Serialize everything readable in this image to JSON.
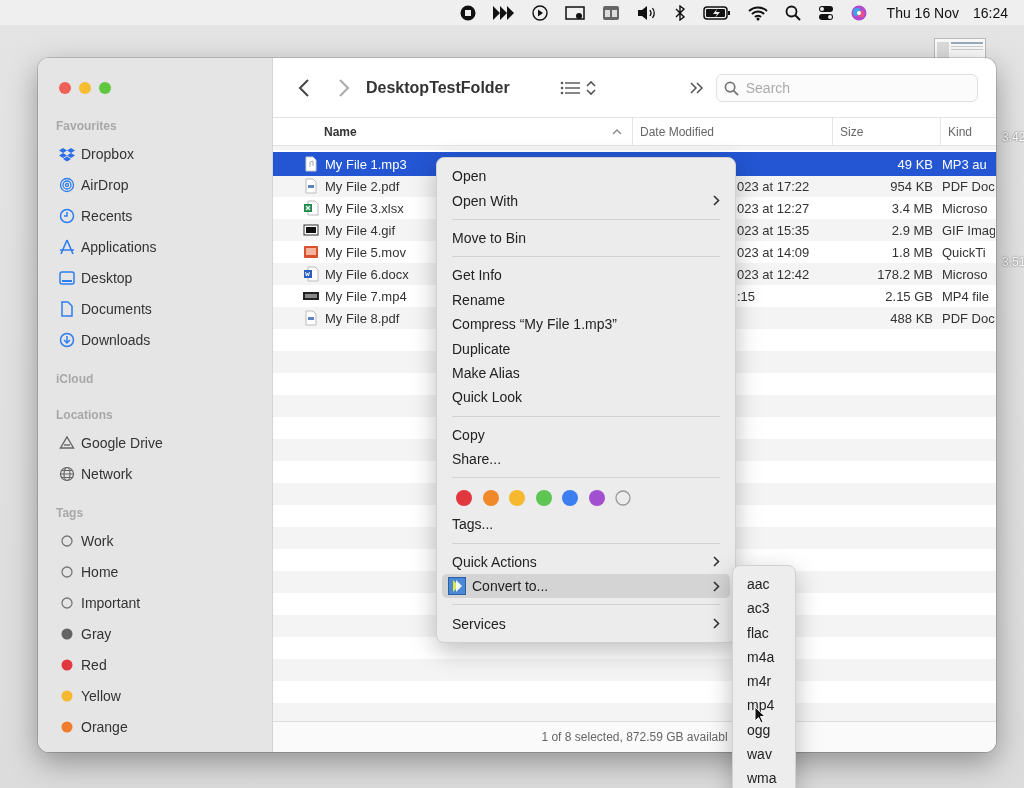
{
  "menu_bar": {
    "date": "Thu 16 Nov",
    "time": "16:24"
  },
  "desktop_fragments": [
    "3.42",
    "3.51"
  ],
  "finder": {
    "title": "DesktopTestFolder",
    "search": {
      "placeholder": "Search"
    },
    "sidebar": [
      {
        "heading": "Favourites",
        "items": [
          {
            "label": "Dropbox",
            "kind": "dropbox"
          },
          {
            "label": "AirDrop",
            "kind": "airdrop"
          },
          {
            "label": "Recents",
            "kind": "recents"
          },
          {
            "label": "Applications",
            "kind": "applications"
          },
          {
            "label": "Desktop",
            "kind": "desktop"
          },
          {
            "label": "Documents",
            "kind": "documents"
          },
          {
            "label": "Downloads",
            "kind": "downloads"
          }
        ]
      },
      {
        "heading": "iCloud"
      },
      {
        "heading": "Locations",
        "items": [
          {
            "label": "Google Drive",
            "kind": "drive"
          },
          {
            "label": "Network",
            "kind": "network"
          }
        ]
      },
      {
        "heading": "Tags",
        "items": [
          {
            "label": "Work",
            "kind": "tag"
          },
          {
            "label": "Home",
            "kind": "tag"
          },
          {
            "label": "Important",
            "kind": "tag"
          },
          {
            "label": "Gray",
            "kind": "tag",
            "color": "#636363"
          },
          {
            "label": "Red",
            "kind": "tag",
            "color": "#e0383e"
          },
          {
            "label": "Yellow",
            "kind": "tag",
            "color": "#f5b82e"
          },
          {
            "label": "Orange",
            "kind": "tag",
            "color": "#f07b2a"
          }
        ]
      }
    ],
    "table": {
      "columns": [
        {
          "label": "Name",
          "sorted": true
        },
        {
          "label": "Date Modified",
          "sorted": false
        },
        {
          "label": "Size",
          "sorted": false
        },
        {
          "label": "Kind",
          "sorted": false
        }
      ],
      "rows": [
        {
          "name": "My File 1.mp3",
          "kind": "audio",
          "size": "49 KB",
          "file_kind": "MP3 au",
          "selected": true
        },
        {
          "name": "My File 2.pdf",
          "kind": "pdf",
          "date": "023 at 17:22",
          "size": "954 KB",
          "file_kind": "PDF Doc",
          "selected": false
        },
        {
          "name": "My File 3.xlsx",
          "kind": "spreadsheet",
          "date": "023 at 12:27",
          "size": "3.4 MB",
          "file_kind": "Microso",
          "selected": false
        },
        {
          "name": "My File 4.gif",
          "kind": "image",
          "date": "023 at 15:35",
          "size": "2.9 MB",
          "file_kind": "GIF Imag",
          "selected": false
        },
        {
          "name": "My File 5.mov",
          "kind": "video",
          "date": "023 at 14:09",
          "size": "1.8 MB",
          "file_kind": "QuickTi",
          "selected": false
        },
        {
          "name": "My File 6.docx",
          "kind": "document",
          "date": "023 at 12:42",
          "size": "178.2 MB",
          "file_kind": "Microso",
          "selected": false
        },
        {
          "name": "My File 7.mp4",
          "kind": "movie",
          "date": ":15",
          "size": "2.15 GB",
          "file_kind": "MP4 file",
          "selected": false
        },
        {
          "name": "My File 8.pdf",
          "kind": "pdf",
          "size": "488 KB",
          "file_kind": "PDF Doc",
          "selected": false
        }
      ]
    },
    "status": "1 of 8 selected, 872.59 GB availabl"
  },
  "context_menu": {
    "items": [
      {
        "kind": "item",
        "label": "Open",
        "selected": false
      },
      {
        "kind": "submenu",
        "label": "Open With",
        "selected": false
      },
      {
        "kind": "separator"
      },
      {
        "kind": "item",
        "label": "Move to Bin",
        "selected": false
      },
      {
        "kind": "separator"
      },
      {
        "kind": "item",
        "label": "Get Info",
        "selected": false
      },
      {
        "kind": "item",
        "label": "Rename",
        "selected": false
      },
      {
        "kind": "item",
        "label": "Compress “My File 1.mp3”",
        "selected": false
      },
      {
        "kind": "item",
        "label": "Duplicate",
        "selected": false
      },
      {
        "kind": "item",
        "label": "Make Alias",
        "selected": false
      },
      {
        "kind": "item",
        "label": "Quick Look",
        "selected": false
      },
      {
        "kind": "separator"
      },
      {
        "kind": "item",
        "label": "Copy",
        "selected": false
      },
      {
        "kind": "item",
        "label": "Share...",
        "selected": false
      },
      {
        "kind": "separator"
      },
      {
        "kind": "colors",
        "colors": [
          {
            "kind": "dot",
            "color": "#e0383e"
          },
          {
            "kind": "dot",
            "color": "#f0892a"
          },
          {
            "kind": "dot",
            "color": "#f5b82e"
          },
          {
            "kind": "dot",
            "color": "#5ec654"
          },
          {
            "kind": "dot",
            "color": "#3b7ff0"
          },
          {
            "kind": "dot",
            "color": "#a24fd0"
          },
          {
            "kind": "empty"
          }
        ]
      },
      {
        "kind": "item",
        "label": "Tags...",
        "selected": false
      },
      {
        "kind": "separator"
      },
      {
        "kind": "submenu",
        "label": "Quick Actions",
        "selected": false
      },
      {
        "kind": "app_submenu",
        "label": "Convert to...",
        "selected": true
      },
      {
        "kind": "separator"
      },
      {
        "kind": "submenu",
        "label": "Services",
        "selected": false
      }
    ]
  },
  "submenu": {
    "items": [
      "aac",
      "ac3",
      "flac",
      "m4a",
      "m4r",
      "mp4",
      "ogg",
      "wav",
      "wma"
    ]
  }
}
